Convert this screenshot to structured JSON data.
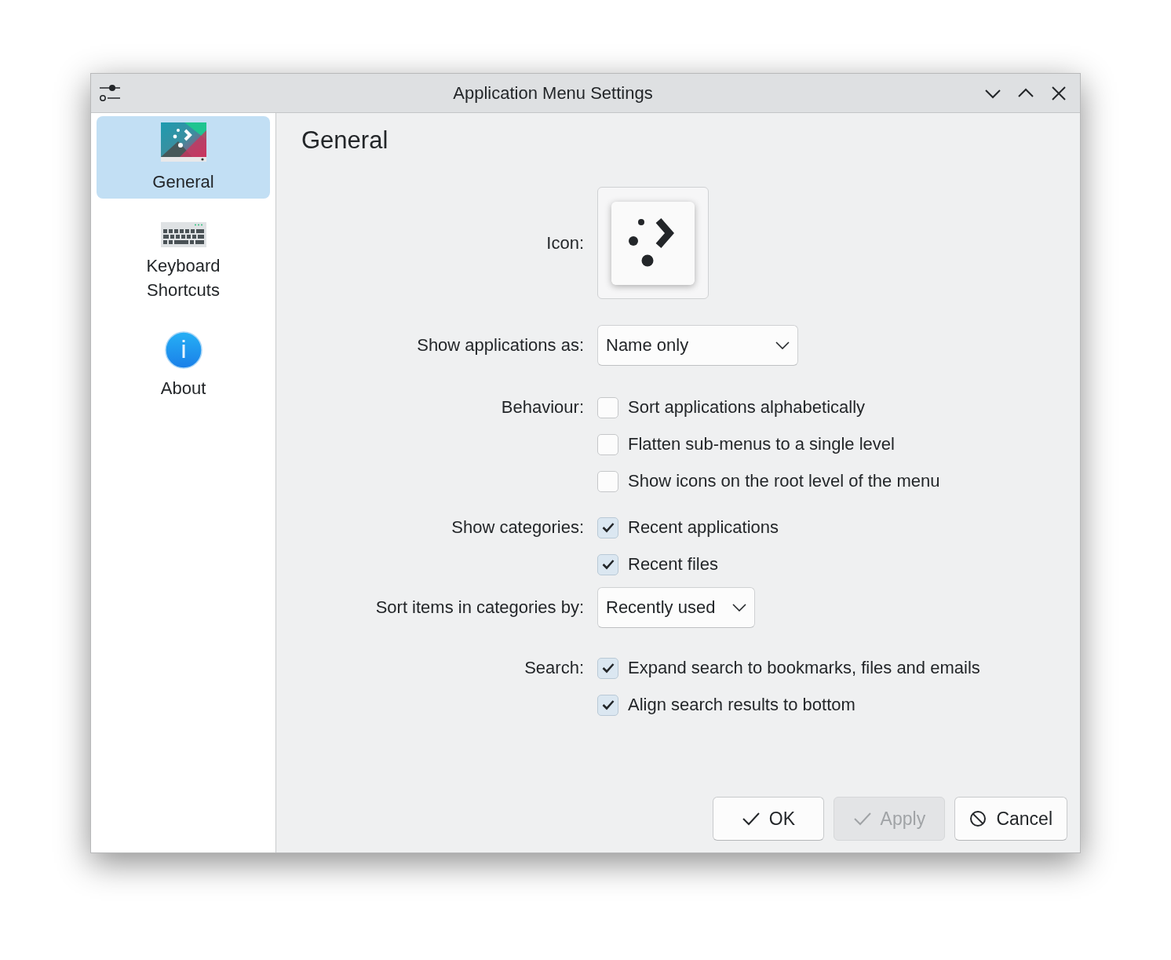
{
  "window": {
    "title": "Application Menu Settings"
  },
  "sidebar": {
    "items": [
      {
        "label": "General",
        "kind": "general",
        "selected": true
      },
      {
        "label": "Keyboard Shortcuts",
        "kind": "keyboard",
        "selected": false
      },
      {
        "label": "About",
        "kind": "about",
        "selected": false
      }
    ]
  },
  "page": {
    "heading": "General",
    "rows": [
      {
        "kind": "icon",
        "label": "Icon:"
      },
      {
        "kind": "combo",
        "label": "Show applications as:",
        "value": "Name only"
      },
      {
        "kind": "checks",
        "label": "Behaviour:",
        "options": [
          {
            "text": "Sort applications alphabetically",
            "checked": false
          },
          {
            "text": "Flatten sub-menus to a single level",
            "checked": false
          },
          {
            "text": "Show icons on the root level of the menu",
            "checked": false
          }
        ]
      },
      {
        "kind": "checks",
        "label": "Show categories:",
        "options": [
          {
            "text": "Recent applications",
            "checked": true
          },
          {
            "text": "Recent files",
            "checked": true
          }
        ]
      },
      {
        "kind": "combo",
        "label": "Sort items in categories by:",
        "value": "Recently used"
      },
      {
        "kind": "checks",
        "label": "Search:",
        "options": [
          {
            "text": "Expand search to bookmarks, files and emails",
            "checked": true
          },
          {
            "text": "Align search results to bottom",
            "checked": true
          }
        ]
      }
    ]
  },
  "buttons": [
    {
      "label": "OK",
      "kind": "confirm",
      "disabled": false
    },
    {
      "label": "Apply",
      "kind": "confirm",
      "disabled": true
    },
    {
      "label": "Cancel",
      "kind": "cancel",
      "disabled": false
    }
  ]
}
